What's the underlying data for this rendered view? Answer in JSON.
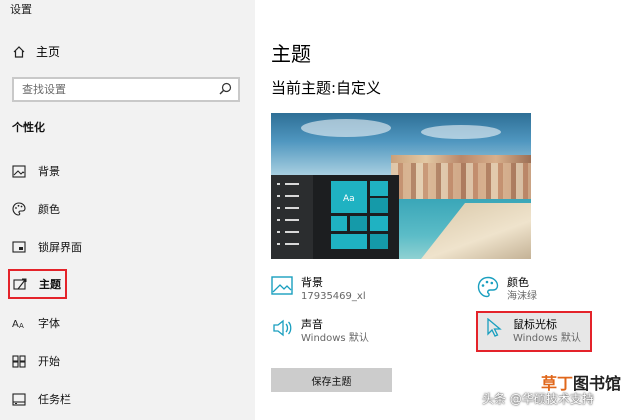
{
  "app": {
    "title": "设置"
  },
  "sidebar": {
    "home_label": "主页",
    "search_placeholder": "查找设置",
    "section_label": "个性化",
    "items": [
      {
        "label": "背景",
        "icon": "picture-icon"
      },
      {
        "label": "颜色",
        "icon": "palette-icon"
      },
      {
        "label": "锁屏界面",
        "icon": "lock-screen-icon"
      },
      {
        "label": "主题",
        "icon": "theme-icon",
        "selected": true
      },
      {
        "label": "字体",
        "icon": "font-icon"
      },
      {
        "label": "开始",
        "icon": "start-icon"
      },
      {
        "label": "任务栏",
        "icon": "taskbar-icon"
      }
    ]
  },
  "main": {
    "title": "主题",
    "current_theme": "当前主题:自定义",
    "preview_tile_text": "Aa",
    "background": {
      "label": "背景",
      "value": "17935469_xl"
    },
    "color": {
      "label": "颜色",
      "value": "海沫绿"
    },
    "sound": {
      "label": "声音",
      "value": "Windows 默认"
    },
    "cursor": {
      "label": "鼠标光标",
      "value": "Windows 默认"
    },
    "save_button": "保存主题"
  },
  "watermark": {
    "handle": "头条 @华硕技术支持",
    "brand_a": "草丁",
    "brand_b": "图书馆"
  },
  "colors": {
    "accent": "#1fb2c2",
    "highlight_border": "#e4232a",
    "sidebar_bg": "#f2f2f2"
  }
}
